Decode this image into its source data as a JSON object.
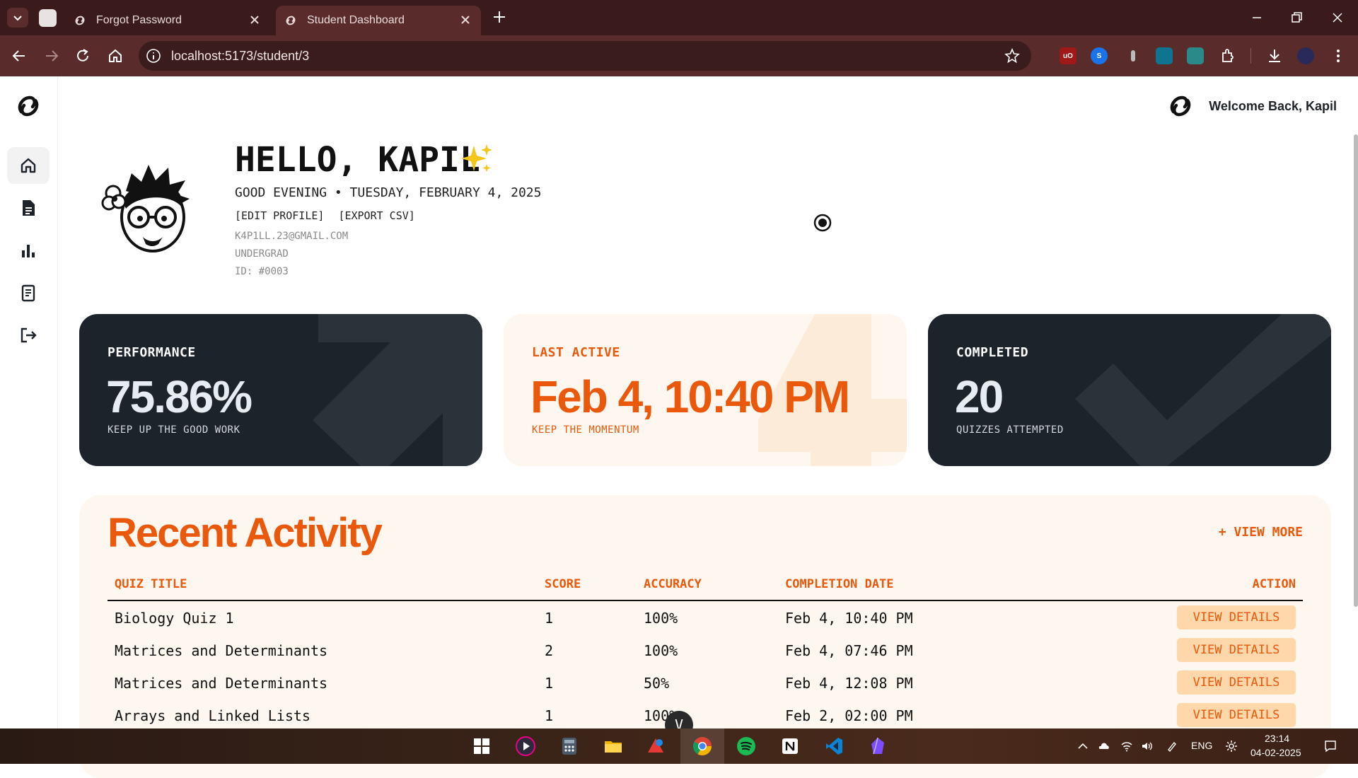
{
  "browser": {
    "tabs": [
      {
        "title": "Forgot Password",
        "active": false
      },
      {
        "title": "Student Dashboard",
        "active": true
      }
    ],
    "url": "localhost:5173/student/3"
  },
  "header": {
    "welcome": "Welcome Back, Kapil"
  },
  "sidebar": {
    "items": [
      {
        "name": "home",
        "active": true
      },
      {
        "name": "document"
      },
      {
        "name": "chart"
      },
      {
        "name": "quiz-list"
      },
      {
        "name": "logout"
      }
    ]
  },
  "profile": {
    "hello": "HELLO, KAPIL",
    "greeting": "GOOD EVENING • TUESDAY, FEBRUARY 4, 2025",
    "edit_label": "[EDIT PROFILE]",
    "export_label": "[EXPORT CSV]",
    "email": "K4P1LL.23@GMAIL.COM",
    "level": "UNDERGRAD",
    "id": "ID: #0003"
  },
  "cards": {
    "performance": {
      "label": "PERFORMANCE",
      "value": "75.86%",
      "sub": "KEEP UP THE GOOD WORK"
    },
    "last_active": {
      "label": "LAST ACTIVE",
      "value": "Feb 4, 10:40 PM",
      "sub": "KEEP THE MOMENTUM"
    },
    "completed": {
      "label": "COMPLETED",
      "value": "20",
      "sub": "QUIZZES ATTEMPTED"
    }
  },
  "activity": {
    "title": "Recent Activity",
    "view_more": "+ VIEW MORE",
    "columns": [
      "QUIZ TITLE",
      "SCORE",
      "ACCURACY",
      "COMPLETION DATE",
      "ACTION"
    ],
    "rows": [
      {
        "title": "Biology Quiz 1",
        "score": "1",
        "accuracy": "100%",
        "date": "Feb 4, 10:40 PM",
        "action": "VIEW DETAILS"
      },
      {
        "title": "Matrices and Determinants",
        "score": "2",
        "accuracy": "100%",
        "date": "Feb 4, 07:46 PM",
        "action": "VIEW DETAILS"
      },
      {
        "title": "Matrices and Determinants",
        "score": "1",
        "accuracy": "50%",
        "date": "Feb 4, 12:08 PM",
        "action": "VIEW DETAILS"
      },
      {
        "title": "Arrays and Linked Lists",
        "score": "1",
        "accuracy": "100%",
        "date": "Feb 2, 02:00 PM",
        "action": "VIEW DETAILS"
      }
    ]
  },
  "fab_label": "V",
  "taskbar": {
    "lang": "ENG",
    "time": "23:14",
    "date": "04-02-2025"
  },
  "colors": {
    "accent": "#ea580c",
    "dark_card": "#1d232a",
    "light_card": "#fef7ef",
    "chrome": "#5a2b2b"
  }
}
